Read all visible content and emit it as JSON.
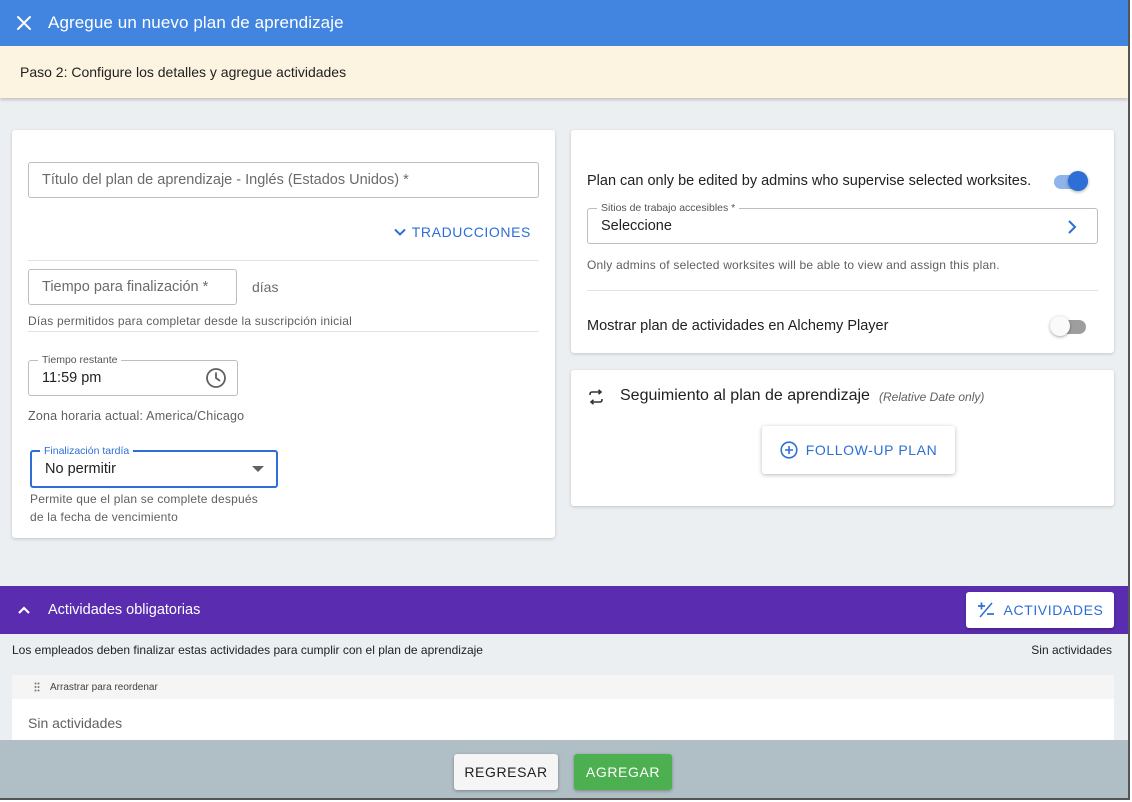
{
  "header": {
    "title": "Agregue un nuevo plan de aprendizaje",
    "close_icon": "close-icon"
  },
  "step": {
    "text": "Paso 2: Configure los detalles y agregue actividades"
  },
  "details": {
    "title_field": {
      "placeholder": "Título del plan de aprendizaje - Inglés (Estados Unidos) *",
      "value": ""
    },
    "translations_label": "TRADUCCIONES",
    "completion_time": {
      "placeholder": "Tiempo para finalización *",
      "value": "",
      "unit": "días",
      "helper": "Días permitidos para completar desde la suscripción inicial"
    },
    "time_remaining": {
      "label": "Tiempo restante",
      "value": "11:59 pm"
    },
    "timezone": "Zona horaria actual: America/Chicago",
    "late_completion": {
      "label": "Finalización tardía",
      "value": "No permitir",
      "helper_line1": "Permite que el plan se complete después",
      "helper_line2": "de la fecha de vencimiento"
    }
  },
  "permissions": {
    "edit_restriction_label": "Plan can only be edited by admins who supervise selected worksites.",
    "edit_restriction_on": true,
    "worksites": {
      "label": "Sitios de trabajo accesibles *",
      "value": "Seleccione",
      "helper": "Only admins of selected worksites will be able to view and assign this plan."
    },
    "show_in_player_label": "Mostrar plan de actividades en Alchemy Player",
    "show_in_player_on": false
  },
  "followup": {
    "title": "Seguimiento al plan de aprendizaje",
    "subtitle": "(Relative Date only)",
    "button": "FOLLOW-UP PLAN"
  },
  "activities": {
    "title": "Actividades obligatorias",
    "add_button": "ACTIVIDADES",
    "description": "Los empleados deben finalizar estas actividades para cumplir con el plan de aprendizaje",
    "count_text": "Sin actividades",
    "drag_hint": "Arrastrar para reordenar",
    "empty_text": "Sin actividades"
  },
  "footer": {
    "back": "REGRESAR",
    "add": "AGREGAR"
  },
  "colors": {
    "primary": "#4285e0",
    "banner": "#fdf3e1",
    "purple": "#5a2db0",
    "accent_blue": "#2d6fd6",
    "green": "#4caf50",
    "footer": "#b0bec5"
  }
}
